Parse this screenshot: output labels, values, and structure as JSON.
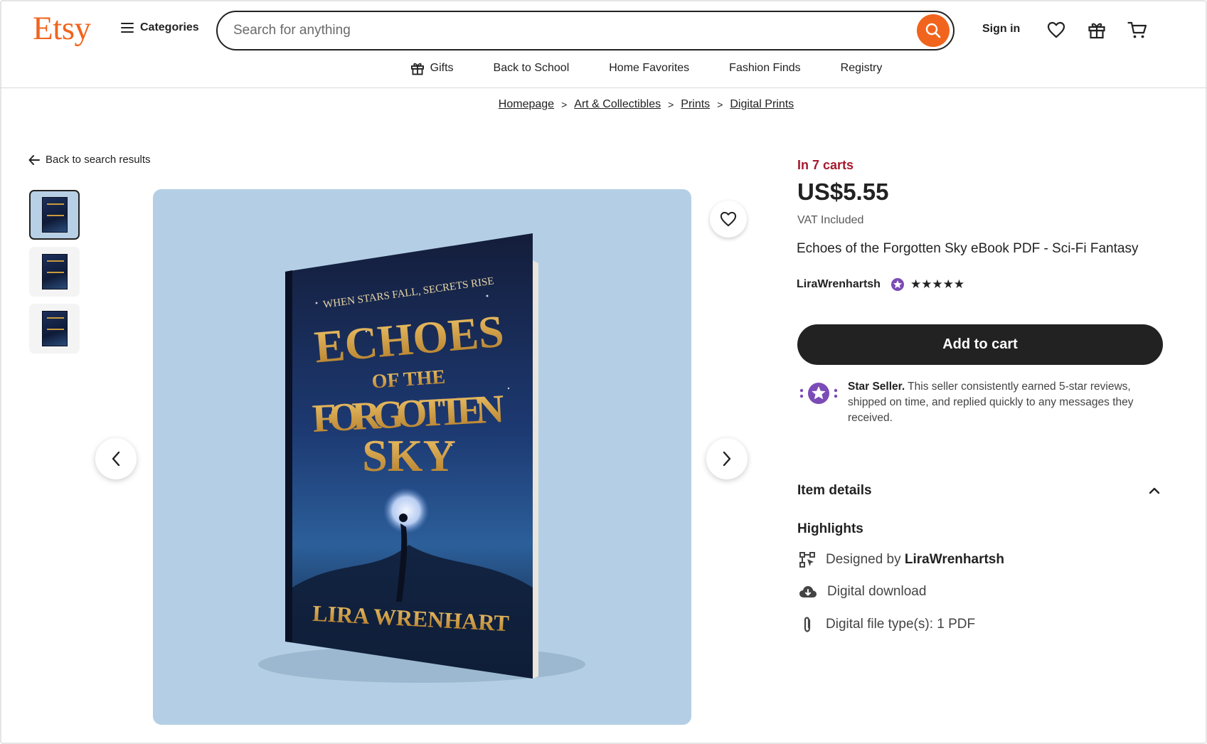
{
  "header": {
    "logo": "Etsy",
    "categories_label": "Categories",
    "search_placeholder": "Search for anything",
    "signin_label": "Sign in"
  },
  "nav": {
    "items": [
      "Gifts",
      "Back to School",
      "Home Favorites",
      "Fashion Finds",
      "Registry"
    ]
  },
  "breadcrumb": [
    "Homepage",
    "Art & Collectibles",
    "Prints",
    "Digital Prints"
  ],
  "back_link": "Back to search results",
  "gallery": {
    "thumbnail_count": 3,
    "active_index": 0
  },
  "product": {
    "cart_notice": "In 7 carts",
    "price": "US$5.55",
    "vat_note": "VAT Included",
    "title": "Echoes of the Forgotten Sky eBook PDF - Sci-Fi Fantasy",
    "seller_name": "LiraWrenhartsh",
    "rating_stars": 5,
    "add_to_cart_label": "Add to cart"
  },
  "star_seller": {
    "heading": "Star Seller.",
    "text": " This seller consistently earned 5-star reviews, shipped on time, and replied quickly to any messages they received."
  },
  "item_details": {
    "heading": "Item details",
    "highlights_heading": "Highlights",
    "designed_by_prefix": "Designed by",
    "designed_by_name": "LiraWrenhartsh",
    "digital_download": "Digital download",
    "file_type": "Digital file type(s): 1 PDF"
  },
  "book_cover": {
    "tagline": "WHEN STARS FALL, SECRETS RISE",
    "title_line1": "ECHOES",
    "title_line2": "OF THE",
    "title_line3": "FORGOTTEN",
    "title_line4": "SKY",
    "author": "LIRA WRENHART"
  },
  "colors": {
    "brand": "#f1641e",
    "cart_notice": "#a61a2e",
    "image_bg": "#b4cfe5",
    "star_seller_purple": "#7b4bb7"
  }
}
